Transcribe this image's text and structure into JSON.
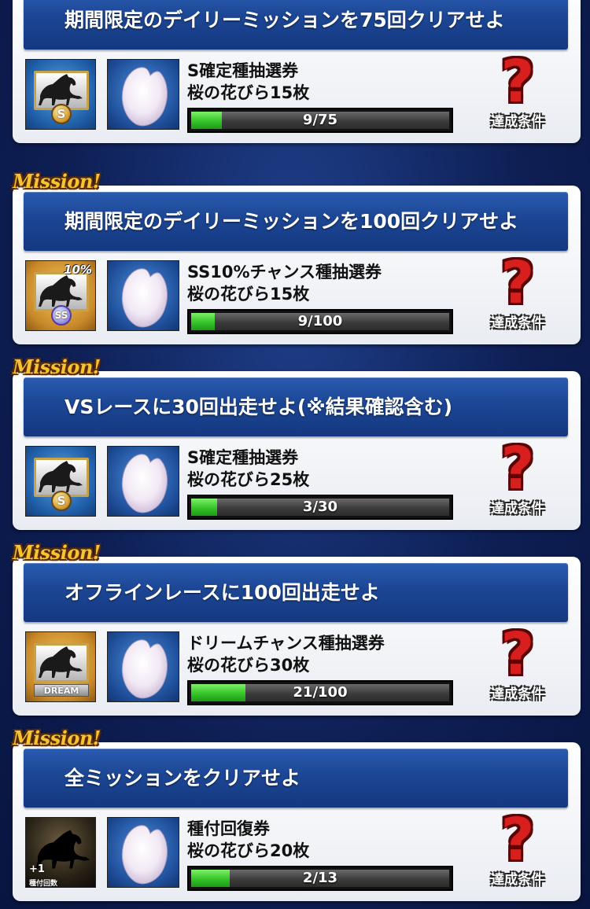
{
  "mission_tag": "Mission!",
  "condition_button_label": "達成条件",
  "missions": [
    {
      "title": "期間限定のデイリーミッションを75回クリアせよ",
      "ticket_icon": "s-ticket-icon",
      "reward_1": "S確定種抽選券",
      "reward_2": "桜の花びら15枚",
      "progress_text": "9/75",
      "progress_fraction": 0.12,
      "show_tag": false
    },
    {
      "title": "期間限定のデイリーミッションを100回クリアせよ",
      "ticket_icon": "ss10-ticket-icon",
      "ticket_badge": "SS",
      "ticket_corner": "10%",
      "reward_1": "SS10%チャンス種抽選券",
      "reward_2": "桜の花びら15枚",
      "progress_text": "9/100",
      "progress_fraction": 0.09,
      "show_tag": true
    },
    {
      "title": "VSレースに30回出走せよ(※結果確認含む)",
      "ticket_icon": "s-ticket-icon",
      "reward_1": "S確定種抽選券",
      "reward_2": "桜の花びら25枚",
      "progress_text": "3/30",
      "progress_fraction": 0.1,
      "show_tag": true
    },
    {
      "title": "オフラインレースに100回出走せよ",
      "ticket_icon": "dream-ticket-icon",
      "ticket_badge": "DREAM",
      "reward_1": "ドリームチャンス種抽選券",
      "reward_2": "桜の花びら30枚",
      "progress_text": "21/100",
      "progress_fraction": 0.21,
      "show_tag": true
    },
    {
      "title": "全ミッションをクリアせよ",
      "ticket_icon": "breeding-recovery-ticket-icon",
      "ticket_plus": "+1",
      "ticket_plus_label": "種付回数",
      "reward_1": "種付回復券",
      "reward_2": "桜の花びら20枚",
      "progress_text": "2/13",
      "progress_fraction": 0.15,
      "show_tag": true
    }
  ],
  "colors": {
    "background": "#0e1f55",
    "title_bar": "#1c4694",
    "progress_fill": "#34c428",
    "mission_tag": "#f4c530",
    "question_mark": "#d91e1e"
  }
}
